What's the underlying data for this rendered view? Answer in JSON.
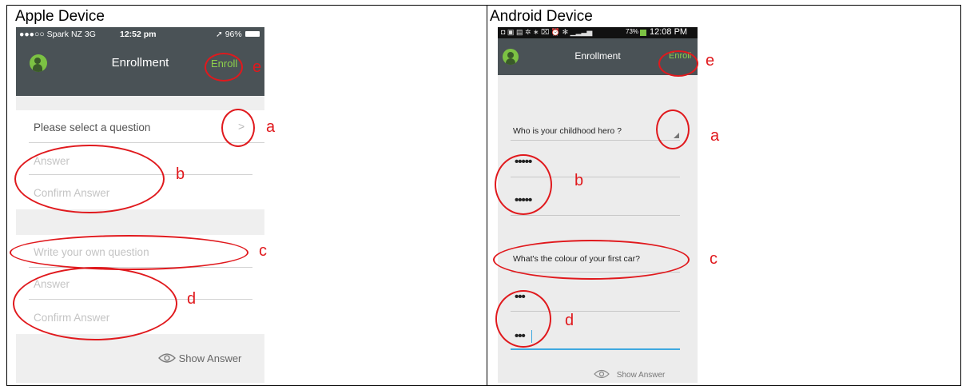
{
  "apple": {
    "heading": "Apple Device",
    "status": {
      "carrier": "●●●○○ Spark NZ  3G",
      "time": "12:52 pm",
      "battery": "➚ 96%"
    },
    "title": "Enrollment",
    "enroll": "Enroll",
    "question_select": "Please select a question",
    "answer_1": "Answer",
    "confirm_1": "Confirm Answer",
    "own_question": "Write your own question",
    "answer_2": "Answer",
    "confirm_2": "Confirm Answer",
    "show_answer": "Show Answer"
  },
  "android": {
    "heading": "Android Device",
    "status": {
      "icons": "◘ ▣ ▤     ✲ ∗ ⌧ ⏰ ✻ ▁▂▃▅",
      "battery": "73%",
      "time": "12:08 PM"
    },
    "title": "Enrollment",
    "enroll": "Enroll",
    "question_1": "Who is your childhood hero ?",
    "answer_1": "•••••",
    "confirm_1": "•••••",
    "question_2": "What's the colour of your first car?",
    "answer_2": "•••",
    "confirm_2": "•••",
    "show_answer": "Show Answer"
  },
  "annotations": {
    "a": "a",
    "b": "b",
    "c": "c",
    "d": "d",
    "e": "e"
  },
  "colors": {
    "annotation": "#e0191d",
    "navbar": "#4a5256",
    "accent": "#8ed14c",
    "active_line": "#3fa9e0"
  }
}
